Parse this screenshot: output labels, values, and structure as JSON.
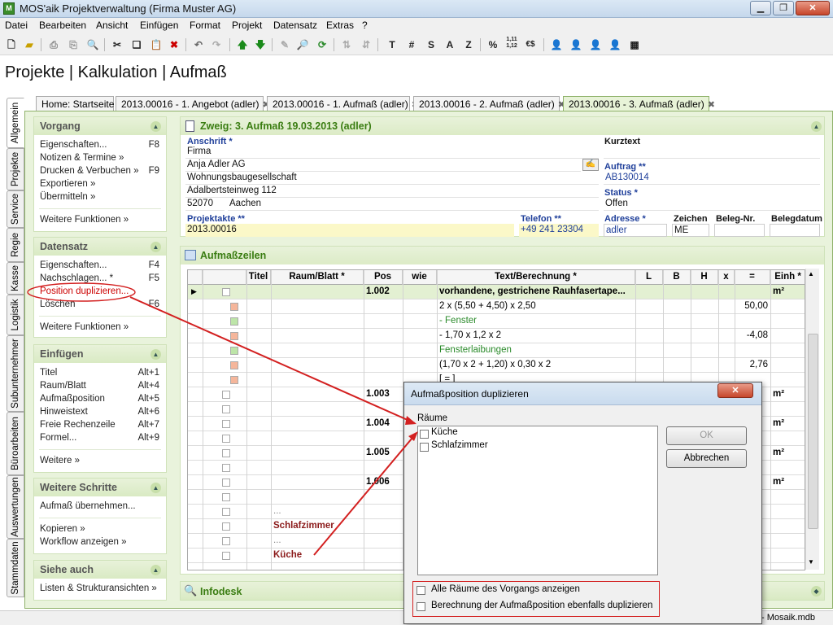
{
  "window": {
    "title": "MOS'aik Projektverwaltung (Firma Muster AG)",
    "app_icon_text": "M"
  },
  "menu": [
    "Datei",
    "Bearbeiten",
    "Ansicht",
    "Einfügen",
    "Format",
    "Projekt",
    "Datensatz",
    "Extras",
    "?"
  ],
  "toolbar": {
    "text_buttons": [
      "T",
      "#",
      "S",
      "A",
      "Z",
      "%",
      "1,11\n1,12",
      "€$"
    ]
  },
  "header": {
    "title": "Projekte | Kalkulation | Aufmaß"
  },
  "doc_tabs": [
    {
      "label": "Home: Startseite",
      "closable": false,
      "active": false
    },
    {
      "label": "2013.00016 - 1. Angebot (adler)",
      "closable": true,
      "active": false
    },
    {
      "label": "2013.00016 - 1. Aufmaß (adler)",
      "closable": true,
      "active": false
    },
    {
      "label": "2013.00016 - 2. Aufmaß (adler)",
      "closable": true,
      "active": false
    },
    {
      "label": "2013.00016 - 3. Aufmaß (adler)",
      "closable": true,
      "active": true
    }
  ],
  "vertical_tabs": [
    "Allgemein",
    "Projekte",
    "Service",
    "Regie",
    "Kasse",
    "Logistik",
    "Subunternehmer",
    "Büroarbeiten",
    "Auswertungen",
    "Stammdaten"
  ],
  "sidebar": {
    "vorgang": {
      "title": "Vorgang",
      "items": [
        {
          "label": "Eigenschaften...",
          "key": "F8"
        },
        {
          "label": "Notizen & Termine »",
          "key": ""
        },
        {
          "label": "Drucken & Verbuchen »",
          "key": "F9"
        },
        {
          "label": "Exportieren »",
          "key": ""
        },
        {
          "label": "Übermitteln »",
          "key": ""
        }
      ],
      "more": "Weitere Funktionen »"
    },
    "datensatz": {
      "title": "Datensatz",
      "items": [
        {
          "label": "Eigenschaften...",
          "key": "F4"
        },
        {
          "label": "Nachschlagen... *",
          "key": "F5"
        },
        {
          "label": "Position duplizieren...",
          "key": ""
        },
        {
          "label": "Löschen",
          "key": "F6"
        }
      ],
      "more": "Weitere Funktionen »"
    },
    "einfuegen": {
      "title": "Einfügen",
      "items": [
        {
          "label": "Titel",
          "key": "Alt+1"
        },
        {
          "label": "Raum/Blatt",
          "key": "Alt+4"
        },
        {
          "label": "Aufmaßposition",
          "key": "Alt+5"
        },
        {
          "label": "Hinweistext",
          "key": "Alt+6"
        },
        {
          "label": "Freie Rechenzeile",
          "key": "Alt+7"
        },
        {
          "label": "Formel...",
          "key": "Alt+9"
        }
      ],
      "more": "Weitere »"
    },
    "weitere_schritte": {
      "title": "Weitere Schritte",
      "items": [
        {
          "label": "Aufmaß übernehmen...",
          "key": ""
        },
        {
          "label": "Kopieren »",
          "key": ""
        },
        {
          "label": "Workflow anzeigen »",
          "key": ""
        }
      ]
    },
    "siehe_auch": {
      "title": "Siehe auch",
      "items": [
        {
          "label": "Listen & Strukturansichten »",
          "key": ""
        }
      ]
    }
  },
  "zweig": {
    "title": "Zweig: 3. Aufmaß 19.03.2013 (adler)",
    "anschrift_label": "Anschrift *",
    "anschrift": [
      "Firma",
      "Anja Adler AG",
      "Wohnungsbaugesellschaft",
      "Adalbertsteinweg 112"
    ],
    "plz": "52070",
    "ort": "Aachen",
    "kurztext_label": "Kurztext",
    "kurztext": "",
    "auftrag_label": "Auftrag **",
    "auftrag": "AB130014",
    "status_label": "Status *",
    "status": "Offen",
    "projektakte_label": "Projektakte **",
    "projektakte": "2013.00016",
    "telefon_label": "Telefon **",
    "telefon": "+49 241 23304",
    "adresse_label": "Adresse *",
    "adresse": "adler",
    "zeichen_label": "Zeichen",
    "zeichen": "ME",
    "belegnr_label": "Beleg-Nr.",
    "belegnr": "",
    "belegdatum_label": "Belegdatum",
    "belegdatum": ""
  },
  "aufmass": {
    "title": "Aufmaßzeilen",
    "columns": [
      "Titel",
      "Raum/Blatt *",
      "Pos",
      "wie",
      "Text/Berechnung *",
      "L",
      "B",
      "H",
      "x",
      "=",
      "Einh *"
    ],
    "rows": [
      {
        "titel": "",
        "raum": "",
        "pos": "1.002",
        "text": "vorhandene, gestrichene Rauhfasertape...",
        "result": "",
        "unit": "m²",
        "selected": true
      },
      {
        "titel": "",
        "raum": "",
        "pos": "",
        "text": "2 x (5,50 + 4,50) x 2,50",
        "result": "50,00",
        "unit": ""
      },
      {
        "titel": "",
        "raum": "",
        "pos": "",
        "text": "- Fenster",
        "result": "",
        "unit": ""
      },
      {
        "titel": "",
        "raum": "",
        "pos": "",
        "text": "- 1,70 x 1,2 x 2",
        "result": "-4,08",
        "unit": ""
      },
      {
        "titel": "",
        "raum": "",
        "pos": "",
        "text": "Fensterlaibungen",
        "result": "",
        "unit": ""
      },
      {
        "titel": "",
        "raum": "",
        "pos": "",
        "text": "(1,70 x 2 + 1,20) x 0,30 x 2",
        "result": "2,76",
        "unit": ""
      },
      {
        "titel": "",
        "raum": "",
        "pos": "",
        "text": "[ = ]",
        "result": "",
        "unit": ""
      },
      {
        "titel": "",
        "raum": "",
        "pos": "1.003",
        "text": "",
        "result": "",
        "unit": "m²"
      },
      {
        "titel": "",
        "raum": "",
        "pos": "",
        "text": "",
        "result": "",
        "unit": ""
      },
      {
        "titel": "",
        "raum": "",
        "pos": "1.004",
        "text": "",
        "result": "",
        "unit": "m²"
      },
      {
        "titel": "",
        "raum": "",
        "pos": "",
        "text": "",
        "result": "",
        "unit": ""
      },
      {
        "titel": "",
        "raum": "",
        "pos": "1.005",
        "text": "",
        "result": "",
        "unit": "m²"
      },
      {
        "titel": "",
        "raum": "",
        "pos": "",
        "text": "",
        "result": "",
        "unit": ""
      },
      {
        "titel": "",
        "raum": "",
        "pos": "1.006",
        "text": "",
        "result": "",
        "unit": "m²"
      },
      {
        "titel": "",
        "raum": "",
        "pos": "",
        "text": "",
        "result": "",
        "unit": ""
      },
      {
        "titel": "",
        "raum": "...",
        "pos": "",
        "text": "",
        "result": "",
        "unit": ""
      },
      {
        "titel": "",
        "raum": "Schlafzimmer",
        "pos": "",
        "text": "",
        "result": "",
        "unit": ""
      },
      {
        "titel": "",
        "raum": "...",
        "pos": "",
        "text": "",
        "result": "",
        "unit": ""
      },
      {
        "titel": "",
        "raum": "Küche",
        "pos": "",
        "text": "",
        "result": "",
        "unit": ""
      }
    ]
  },
  "infodesk": {
    "title": "Infodesk"
  },
  "statusbar": {
    "right": "- Mosaik.mdb"
  },
  "dialog": {
    "title": "Aufmaßposition duplizieren",
    "list_label": "Räume",
    "rooms": [
      {
        "label": "Küche",
        "checked": false
      },
      {
        "label": "Schlafzimmer",
        "checked": false
      }
    ],
    "ok": "OK",
    "cancel": "Abbrechen",
    "opt1": "Alle Räume des Vorgangs anzeigen",
    "opt2": "Berechnung der Aufmaßposition ebenfalls duplizieren",
    "opt1_checked": false,
    "opt2_checked": false,
    "close": "✕"
  },
  "colors": {
    "accent_green": "#3a7d12",
    "header_blue": "#1f3f9a",
    "annotation_red": "#d32020",
    "room_red": "#8b1a1a"
  }
}
